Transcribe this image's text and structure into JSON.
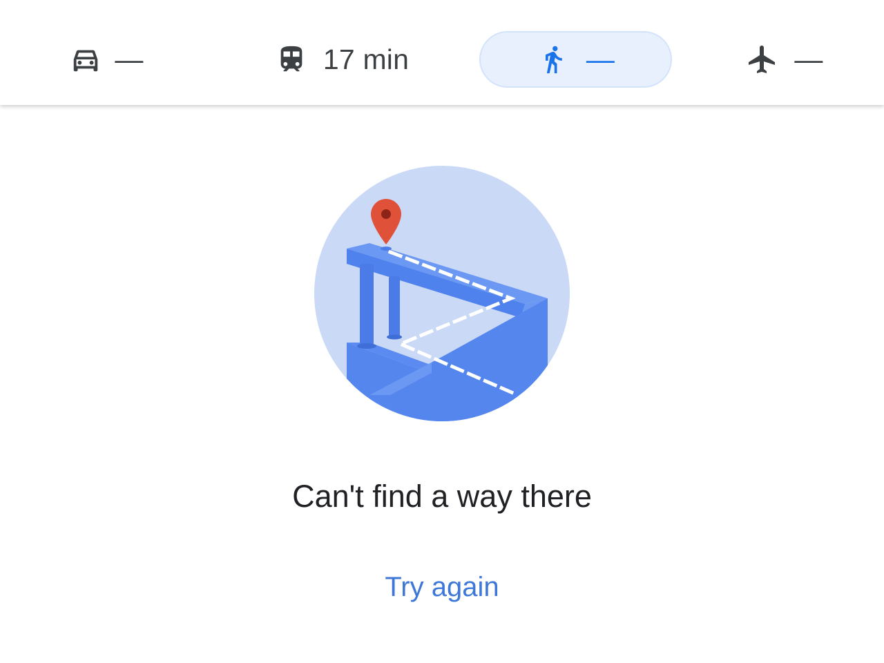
{
  "modes": {
    "drive": {
      "icon": "car-icon",
      "value": "—"
    },
    "transit": {
      "icon": "train-icon",
      "value": "17 min"
    },
    "walk": {
      "icon": "walking-person-icon",
      "value": "—",
      "selected": true
    },
    "flight": {
      "icon": "airplane-icon",
      "value": "—"
    }
  },
  "illustration": {
    "icon": "no-route-illustration",
    "marker_icon": "red-map-pin-icon"
  },
  "message": "Can't find a way there",
  "retry_label": "Try again",
  "colors": {
    "icon_gray": "#3c4043",
    "selected_blue": "#1a73e8",
    "selected_bg": "#e8f0fe",
    "link_blue": "#3d77d8",
    "circle_bg": "#c9d9f6",
    "road_blue": "#5b8bf0",
    "pin_red": "#e0513a"
  }
}
